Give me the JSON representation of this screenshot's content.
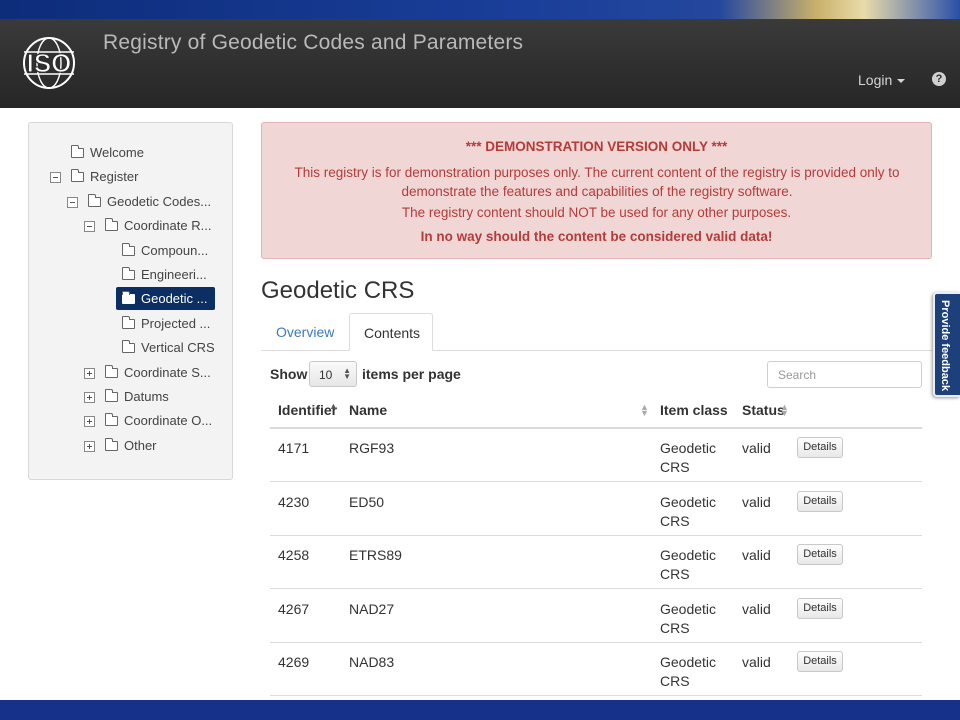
{
  "header": {
    "logo_text": "ISO",
    "app_title": "Registry of Geodetic Codes and Parameters",
    "login_label": "Login",
    "help_label": "?"
  },
  "sidebar": {
    "items": [
      {
        "label": "Welcome",
        "toggle": "none",
        "folder": "closed"
      },
      {
        "label": "Register",
        "toggle": "minus",
        "folder": "open"
      },
      {
        "label": "Geodetic Codes...",
        "toggle": "minus",
        "folder": "open"
      },
      {
        "label": "Coordinate R...",
        "toggle": "minus",
        "folder": "open"
      },
      {
        "label": "Compoun...",
        "toggle": "none",
        "folder": "closed"
      },
      {
        "label": "Engineeri...",
        "toggle": "none",
        "folder": "closed"
      },
      {
        "label": "Geodetic ...",
        "toggle": "none",
        "folder": "closed",
        "selected": true
      },
      {
        "label": "Projected ...",
        "toggle": "none",
        "folder": "closed"
      },
      {
        "label": "Vertical CRS",
        "toggle": "none",
        "folder": "closed"
      },
      {
        "label": "Coordinate S...",
        "toggle": "plus",
        "folder": "closed"
      },
      {
        "label": "Datums",
        "toggle": "plus",
        "folder": "closed"
      },
      {
        "label": "Coordinate O...",
        "toggle": "plus",
        "folder": "closed"
      },
      {
        "label": "Other",
        "toggle": "plus",
        "folder": "closed"
      }
    ]
  },
  "alert": {
    "heading": "*** DEMONSTRATION VERSION ONLY ***",
    "line1": "This registry is for demonstration purposes only. The current content of the registry is provided only to demonstrate the features and capabilities of the registry software.",
    "line2": "The registry content should NOT be used for any other purposes.",
    "line3": "In no way should the content be considered valid data!"
  },
  "main": {
    "title": "Geodetic CRS",
    "tabs": [
      {
        "label": "Overview",
        "active": false
      },
      {
        "label": "Contents",
        "active": true
      }
    ],
    "show_label": "Show",
    "page_size": "10",
    "per_page_label": "items per page",
    "search_placeholder": "Search"
  },
  "table": {
    "columns": [
      "Identifier",
      "Name",
      "Item class",
      "Status"
    ],
    "rows": [
      {
        "id": "4171",
        "name": "RGF93",
        "item_class": "Geodetic CRS",
        "status": "valid",
        "action": "Details"
      },
      {
        "id": "4230",
        "name": "ED50",
        "item_class": "Geodetic CRS",
        "status": "valid",
        "action": "Details"
      },
      {
        "id": "4258",
        "name": "ETRS89",
        "item_class": "Geodetic CRS",
        "status": "valid",
        "action": "Details"
      },
      {
        "id": "4267",
        "name": "NAD27",
        "item_class": "Geodetic CRS",
        "status": "valid",
        "action": "Details"
      },
      {
        "id": "4269",
        "name": "NAD83",
        "item_class": "Geodetic CRS",
        "status": "valid",
        "action": "Details"
      }
    ]
  },
  "feedback": {
    "label": "Provide feedback"
  },
  "colors": {
    "header_bg": "#2f2f2f",
    "alert_bg": "#f1d6d6",
    "alert_text": "#b43c38",
    "link": "#3a7bbf",
    "tree_selected": "#0b2e63",
    "feedback_bg": "#1d3f7a"
  }
}
